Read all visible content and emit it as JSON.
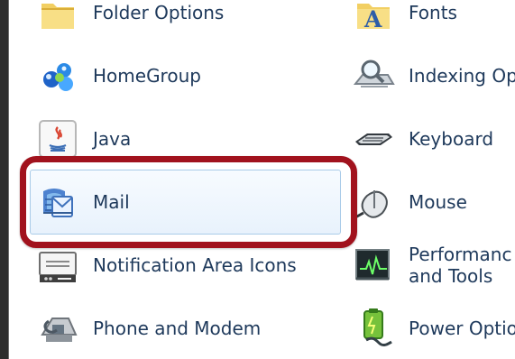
{
  "items_left": [
    {
      "label": "Folder Options",
      "icon": "folder-options-icon"
    },
    {
      "label": "HomeGroup",
      "icon": "homegroup-icon"
    },
    {
      "label": "Java",
      "icon": "java-icon"
    },
    {
      "label": "Mail",
      "icon": "mail-icon"
    },
    {
      "label": "Notification Area Icons",
      "icon": "notification-area-icon"
    },
    {
      "label": "Phone and Modem",
      "icon": "phone-modem-icon"
    }
  ],
  "items_right": [
    {
      "label": "Fonts",
      "icon": "fonts-icon"
    },
    {
      "label": "Indexing Op",
      "icon": "indexing-options-icon"
    },
    {
      "label": "Keyboard",
      "icon": "keyboard-icon"
    },
    {
      "label": "Mouse",
      "icon": "mouse-icon"
    },
    {
      "label_line1": "Performanc",
      "label_line2": "and Tools",
      "icon": "performance-icon"
    },
    {
      "label": "Power Optio",
      "icon": "power-options-icon"
    }
  ],
  "colors": {
    "label": "#1e395b",
    "highlight_ring": "#a1121d",
    "hover_border": "#a9cbe8"
  }
}
